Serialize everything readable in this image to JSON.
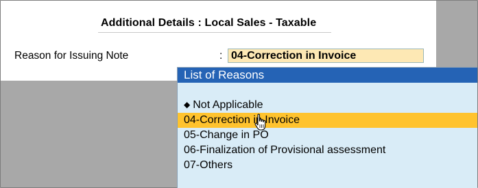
{
  "details": {
    "title": "Additional Details : Local Sales - Taxable",
    "reason_label": "Reason for Issuing Note",
    "colon": ":",
    "reason_value": "04-Correction in Invoice"
  },
  "reasons_list": {
    "title": "List of Reasons",
    "items": [
      {
        "label": "Not Applicable",
        "marker": "diamond-icon",
        "selected": false
      },
      {
        "label": "04-Correction in Invoice",
        "selected": true
      },
      {
        "label": "05-Change in PO",
        "selected": false
      },
      {
        "label": "06-Finalization of Provisional assessment",
        "selected": false
      },
      {
        "label": "07-Others",
        "selected": false
      }
    ]
  },
  "colors": {
    "list_header_bg": "#2563b5",
    "list_bg": "#d9ecf7",
    "selected_bg": "#ffc32e",
    "field_bg": "#fde8b4"
  }
}
